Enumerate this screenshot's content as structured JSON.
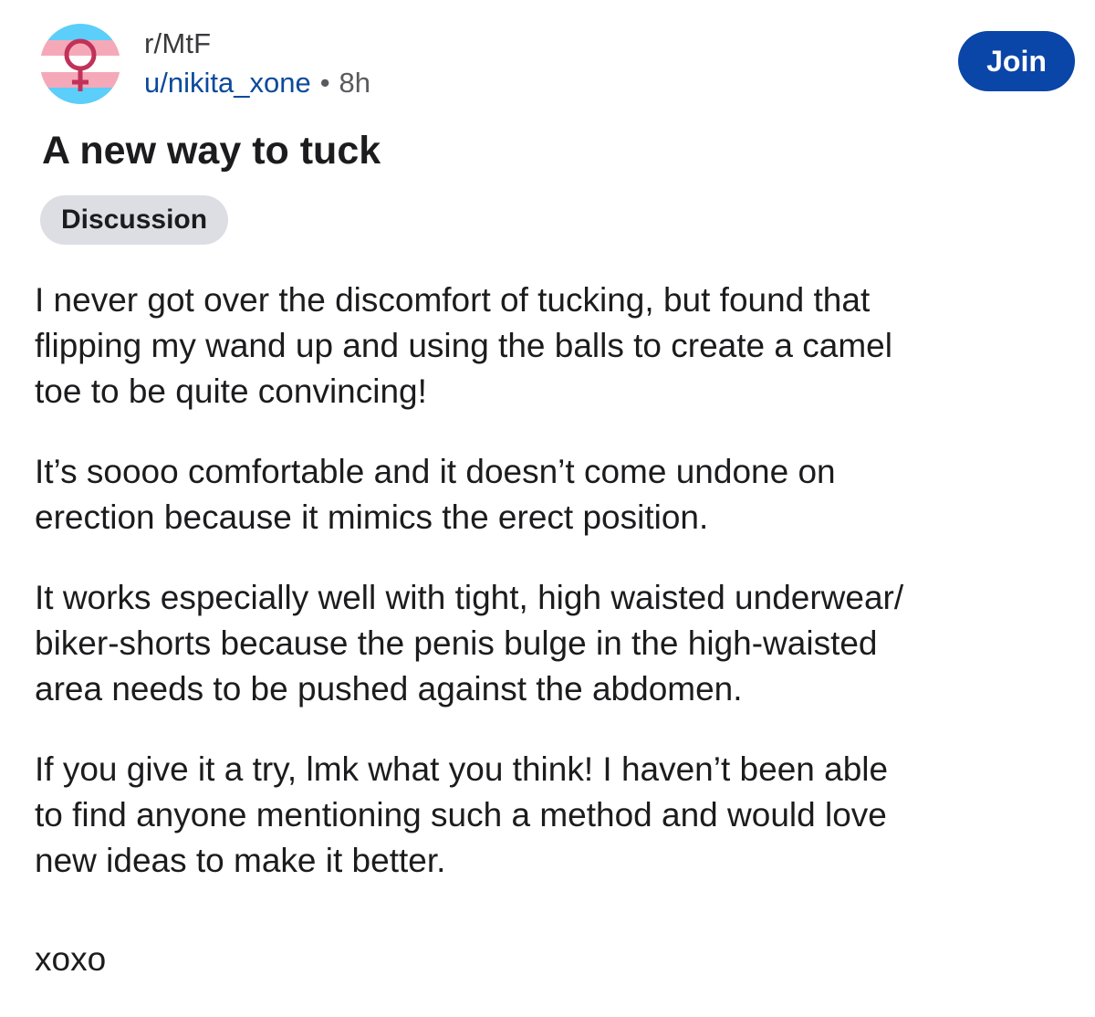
{
  "post": {
    "subreddit": "r/MtF",
    "username": "u/nikita_xone",
    "separator": "•",
    "time": "8h",
    "join_label": "Join",
    "title": "A new way to tuck",
    "flair": "Discussion",
    "paragraphs": [
      "I never got over the discomfort of tucking, but found that\nflipping my wand up and using the balls to create a camel\ntoe to be quite convincing!",
      "It’s soooo comfortable and it doesn’t come undone on\nerection because it mimics the erect position.",
      "It works especially well with tight, high waisted underwear/\nbiker-shorts because the penis bulge in the high-waisted\narea needs to be pushed against the abdomen.",
      "If you give it a try, lmk what you think! I haven’t been able\nto find anyone mentioning such a method and would love\nnew ideas to make it better.",
      "xoxo"
    ]
  },
  "colors": {
    "accent": "#0a45a8",
    "username": "#0b4a9c",
    "flair_bg": "#dcdee3",
    "flag_blue": "#5bcefa",
    "flag_pink": "#f5a9b8",
    "symbol": "#c0325a"
  },
  "icons": {
    "avatar": "trans-flag-venus-icon"
  }
}
